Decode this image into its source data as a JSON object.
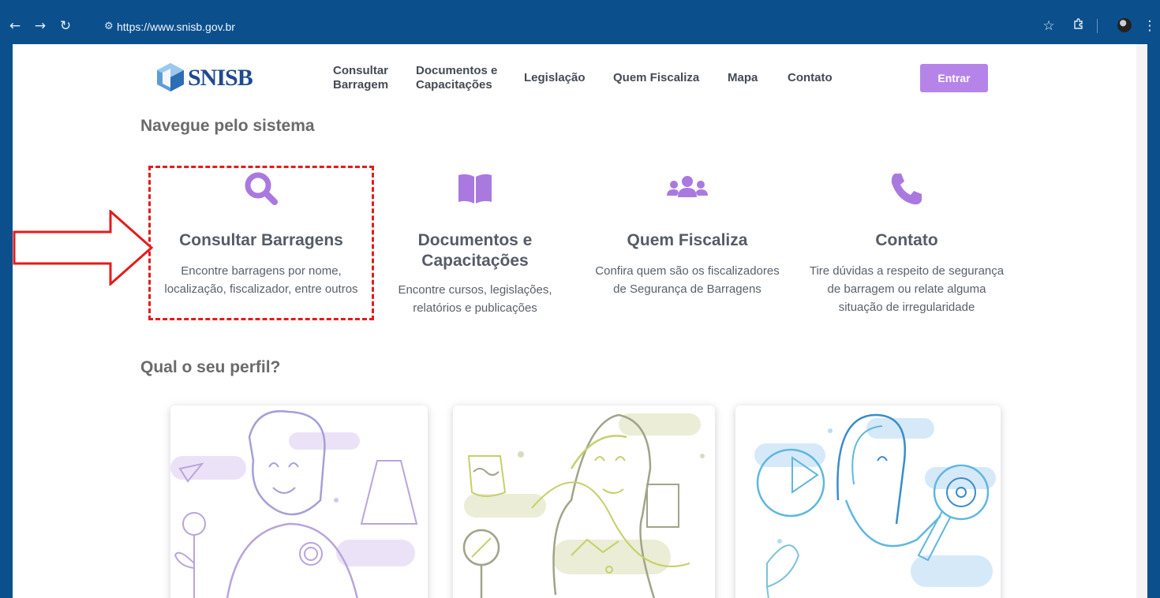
{
  "browser": {
    "url": "https://www.snisb.gov.br",
    "back_icon": "arrow-left-icon",
    "forward_icon": "arrow-right-icon",
    "reload_icon": "reload-icon",
    "site_info_icon": "site-info-icon",
    "bookmark_icon": "star-icon",
    "extensions_icon": "puzzle-icon",
    "menu_icon": "kebab-menu-icon"
  },
  "header": {
    "logo_text": "SNISB",
    "nav": [
      {
        "line1": "Consultar",
        "line2": "Barragem"
      },
      {
        "line1": "Documentos e",
        "line2": "Capacitações"
      },
      {
        "line1": "Legislação",
        "line2": ""
      },
      {
        "line1": "Quem Fiscaliza",
        "line2": ""
      },
      {
        "line1": "Mapa",
        "line2": ""
      },
      {
        "line1": "Contato",
        "line2": ""
      }
    ],
    "login_label": "Entrar"
  },
  "navigate": {
    "title": "Navegue pelo sistema",
    "features": [
      {
        "icon": "search-icon",
        "title_1": "Consultar Barragens",
        "title_2": "",
        "desc_1": "Encontre barragens por nome,",
        "desc_2": "localização, fiscalizador, entre outros",
        "desc_3": ""
      },
      {
        "icon": "book-icon",
        "title_1": "Documentos e",
        "title_2": "Capacitações",
        "desc_1": "Encontre cursos, legislações,",
        "desc_2": "relatórios e publicações",
        "desc_3": ""
      },
      {
        "icon": "users-icon",
        "title_1": "Quem Fiscaliza",
        "title_2": "",
        "desc_1": "Confira quem são os fiscalizadores",
        "desc_2": "de Segurança de Barragens",
        "desc_3": ""
      },
      {
        "icon": "phone-icon",
        "title_1": "Contato",
        "title_2": "",
        "desc_1": "Tire dúvidas a respeito de segurança",
        "desc_2": "de barragem ou relate alguma",
        "desc_3": "situação de irregularidade"
      }
    ]
  },
  "profile": {
    "title": "Qual o seu perfil?"
  },
  "colors": {
    "accent": "#b684e8",
    "icon": "#a979e0",
    "annotation": "#e51b1b",
    "frame": "#0b4f8c"
  }
}
